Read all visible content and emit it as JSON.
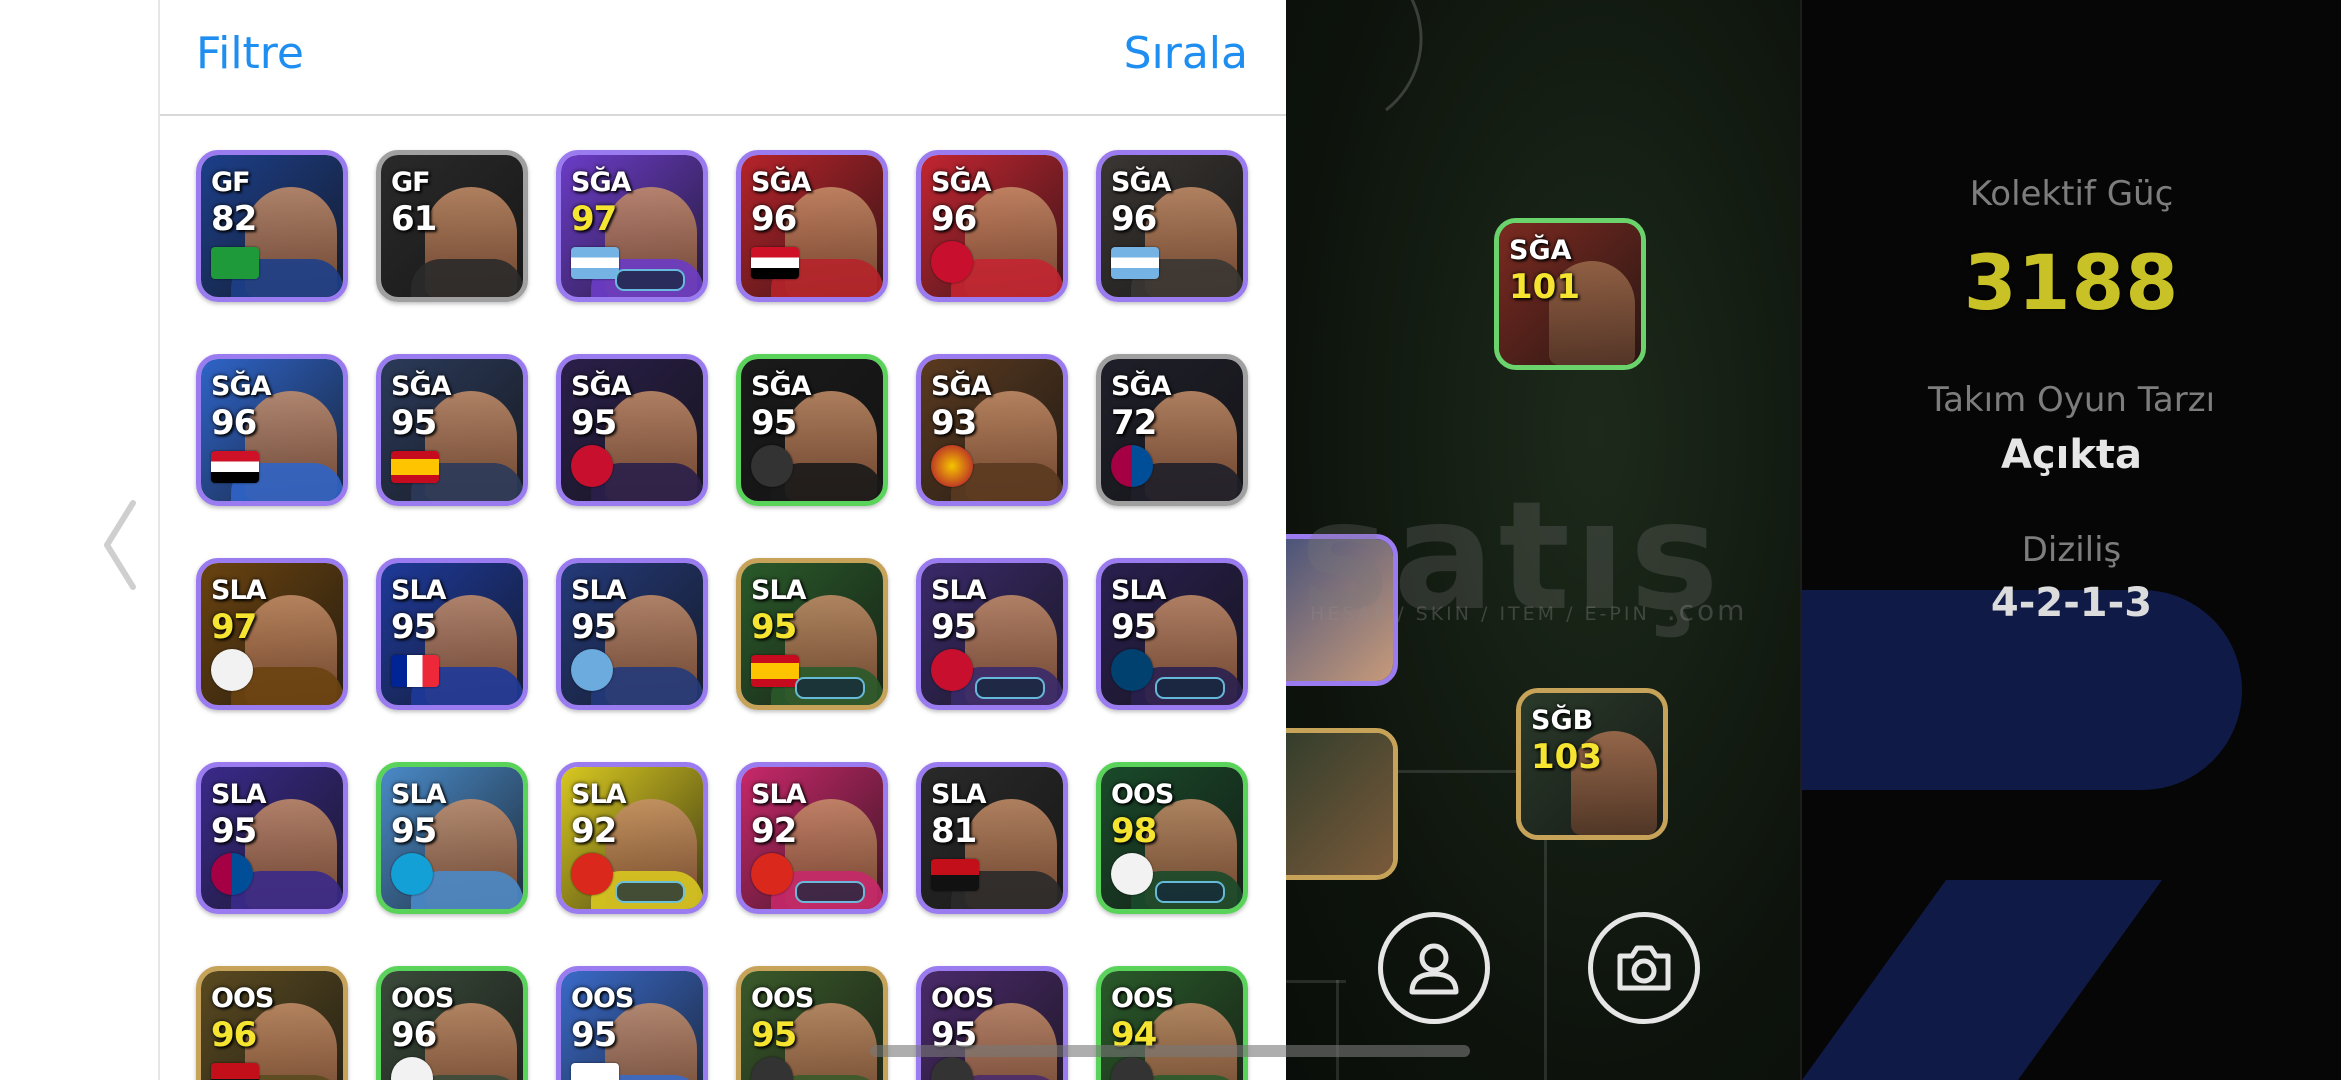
{
  "header": {
    "filter_label": "Filtre",
    "sort_label": "Sırala"
  },
  "players": [
    {
      "pos": "GF",
      "rating": "82",
      "border": "#9b7bf0",
      "bg": "#1d3f8a",
      "badge": "br",
      "chip": false
    },
    {
      "pos": "GF",
      "rating": "61",
      "border": "#a0a0a0",
      "bg": "#2a2a2a",
      "badge": "none",
      "chip": false
    },
    {
      "pos": "SĞA",
      "rating": "97",
      "border": "#9b7bf0",
      "bg": "#6b3cc7",
      "badge": "ar",
      "chip": true,
      "gold": true
    },
    {
      "pos": "SĞA",
      "rating": "96",
      "border": "#9b7bf0",
      "bg": "#b6232a",
      "badge": "eg",
      "chip": false
    },
    {
      "pos": "SĞA",
      "rating": "96",
      "border": "#9b7bf0",
      "bg": "#c32531",
      "badge": "ars",
      "chip": false
    },
    {
      "pos": "SĞA",
      "rating": "96",
      "border": "#9b7bf0",
      "bg": "#3a3633",
      "badge": "ar",
      "chip": false
    },
    {
      "pos": "SĞA",
      "rating": "96",
      "border": "#9b7bf0",
      "bg": "#2f64c8",
      "badge": "eg",
      "chip": false
    },
    {
      "pos": "SĞA",
      "rating": "95",
      "border": "#9b7bf0",
      "bg": "#2b3a5a",
      "badge": "es",
      "chip": false
    },
    {
      "pos": "SĞA",
      "rating": "95",
      "border": "#9b7bf0",
      "bg": "#2a1f4a",
      "badge": "ars",
      "chip": false
    },
    {
      "pos": "SĞA",
      "rating": "95",
      "border": "#5ad35a",
      "bg": "#1a1a1a",
      "badge": "club",
      "chip": false
    },
    {
      "pos": "SĞA",
      "rating": "93",
      "border": "#9b7bf0",
      "bg": "#5a3a20",
      "badge": "gs",
      "chip": false
    },
    {
      "pos": "SĞA",
      "rating": "72",
      "border": "#a0a0a0",
      "bg": "#1f1f2a",
      "badge": "fcb",
      "chip": false
    },
    {
      "pos": "SLA",
      "rating": "97",
      "border": "#9b7bf0",
      "bg": "#6a4310",
      "badge": "rm",
      "chip": false,
      "gold": true
    },
    {
      "pos": "SLA",
      "rating": "95",
      "border": "#9b7bf0",
      "bg": "#1e3a9a",
      "badge": "fr",
      "chip": false
    },
    {
      "pos": "SLA",
      "rating": "95",
      "border": "#9b7bf0",
      "bg": "#243a7a",
      "badge": "mc",
      "chip": false
    },
    {
      "pos": "SLA",
      "rating": "95",
      "border": "#c7a35a",
      "bg": "#2a5a2a",
      "badge": "es",
      "chip": true,
      "gold": true
    },
    {
      "pos": "SLA",
      "rating": "95",
      "border": "#9b7bf0",
      "bg": "#3a2a6a",
      "badge": "ars",
      "chip": true
    },
    {
      "pos": "SLA",
      "rating": "95",
      "border": "#9b7bf0",
      "bg": "#2a2050",
      "badge": "psg",
      "chip": true
    },
    {
      "pos": "SLA",
      "rating": "95",
      "border": "#9b7bf0",
      "bg": "#3a2a8a",
      "badge": "fcb",
      "chip": false
    },
    {
      "pos": "SLA",
      "rating": "95",
      "border": "#5ad35a",
      "bg": "#4a8ac8",
      "badge": "nap",
      "chip": false
    },
    {
      "pos": "SLA",
      "rating": "92",
      "border": "#9b7bf0",
      "bg": "#d8c820",
      "badge": "mu",
      "chip": true
    },
    {
      "pos": "SLA",
      "rating": "92",
      "border": "#9b7bf0",
      "bg": "#c8286a",
      "badge": "mu",
      "chip": true
    },
    {
      "pos": "SLA",
      "rating": "81",
      "border": "#9b7bf0",
      "bg": "#2a2a2a",
      "badge": "fla",
      "chip": false
    },
    {
      "pos": "OOS",
      "rating": "98",
      "border": "#5ad35a",
      "bg": "#1a4a2a",
      "badge": "rm",
      "chip": true,
      "gold": true
    },
    {
      "pos": "OOS",
      "rating": "96",
      "border": "#c7a35a",
      "bg": "#5a4a20",
      "badge": "fla",
      "chip": false,
      "gold": true
    },
    {
      "pos": "OOS",
      "rating": "96",
      "border": "#5ad35a",
      "bg": "#3a4a3a",
      "badge": "rm",
      "chip": false
    },
    {
      "pos": "OOS",
      "rating": "95",
      "border": "#9b7bf0",
      "bg": "#3a6ac8",
      "badge": "en",
      "chip": false
    },
    {
      "pos": "OOS",
      "rating": "95",
      "border": "#c7a35a",
      "bg": "#3a5a2a",
      "badge": "club",
      "chip": false,
      "gold": true
    },
    {
      "pos": "OOS",
      "rating": "95",
      "border": "#9b7bf0",
      "bg": "#4a2a6a",
      "badge": "club",
      "chip": false
    },
    {
      "pos": "OOS",
      "rating": "94",
      "border": "#5ad35a",
      "bg": "#2a5a2a",
      "badge": "club",
      "chip": false,
      "gold": true
    }
  ],
  "pitch_players": [
    {
      "pos": "SĞA",
      "rating": "101",
      "border": "#6bd36b",
      "bg": "#7a2a20"
    },
    {
      "pos": "SĞB",
      "rating": "103",
      "border": "#c7a35a",
      "bg": "#2a3a2a"
    }
  ],
  "stats": {
    "power_label": "Kolektif Güç",
    "power_value": "3188",
    "style_label": "Takım Oyun Tarzı",
    "style_value": "Açıkta",
    "formation_label": "Diziliş",
    "formation_value": "4-2-1-3"
  },
  "watermark": {
    "text": "satış",
    "sub": "HESAP / SKIN / ITEM / E-PIN",
    "dotcom": ".com"
  },
  "icons": {
    "back": "chevron-left-icon",
    "profile": "person-icon",
    "camera": "camera-icon"
  }
}
